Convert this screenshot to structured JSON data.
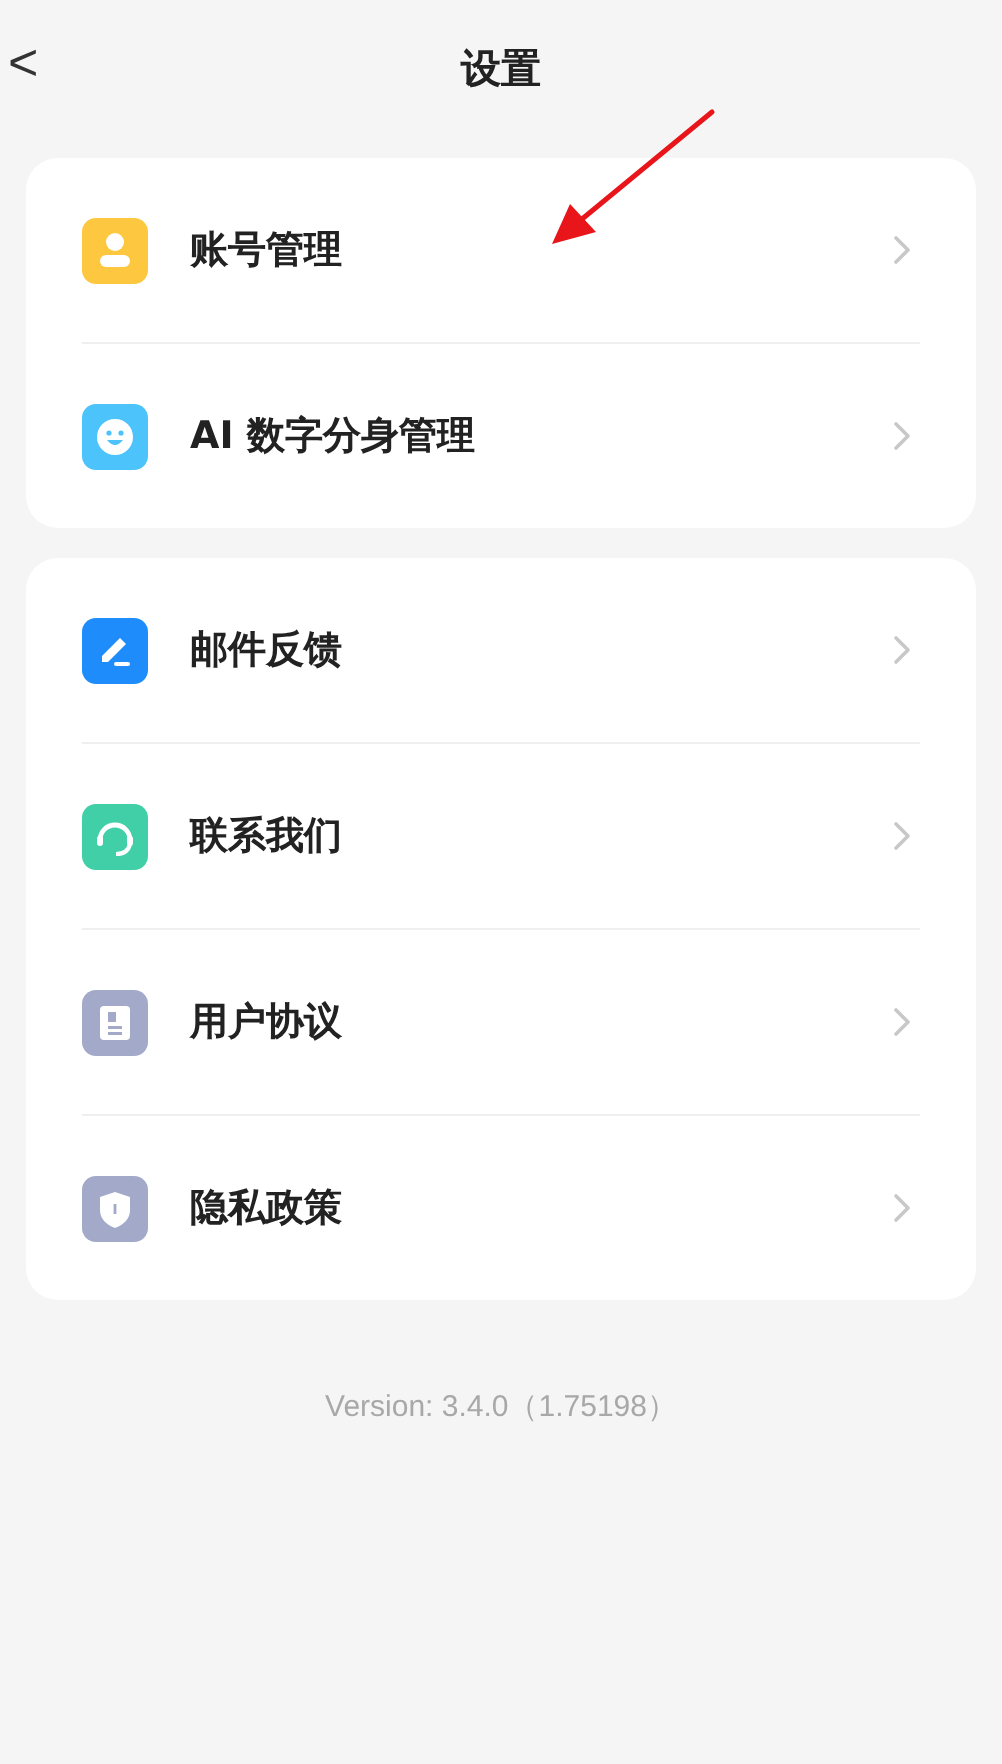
{
  "header": {
    "back": "<",
    "title": "设置"
  },
  "groups": [
    {
      "items": [
        {
          "label": "账号管理",
          "kind": "person",
          "color": "#fdc840"
        },
        {
          "label": "AI 数字分身管理",
          "kind": "smile",
          "color": "#4cc4fb"
        }
      ]
    },
    {
      "items": [
        {
          "label": "邮件反馈",
          "kind": "pen",
          "color": "#1e8cfb"
        },
        {
          "label": "联系我们",
          "kind": "headset",
          "color": "#40cfa7"
        },
        {
          "label": "用户协议",
          "kind": "document",
          "color": "#a2a9c9"
        },
        {
          "label": "隐私政策",
          "kind": "shield",
          "color": "#a2a9c9"
        }
      ]
    }
  ],
  "version": "Version: 3.4.0（1.75198）"
}
